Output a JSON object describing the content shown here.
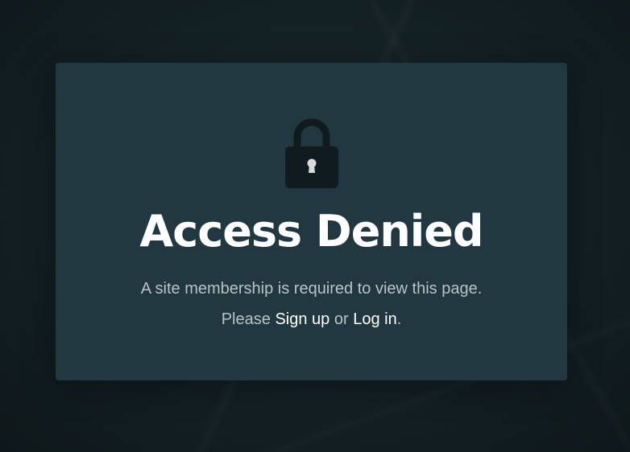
{
  "page": {
    "icon": "lock-icon",
    "title": "Access Denied",
    "message_before": "A site membership is required to view this page. Please",
    "signup_label": "Sign up",
    "message_middle": "or",
    "login_label": "Log in",
    "message_after": "."
  },
  "colors": {
    "background": "#132024",
    "card": "#223840",
    "lock": "#0f1b1f",
    "keyhole": "#d9d9d9",
    "title": "#ffffff",
    "body_text": "#b9c3c6",
    "link": "#ffffff"
  }
}
